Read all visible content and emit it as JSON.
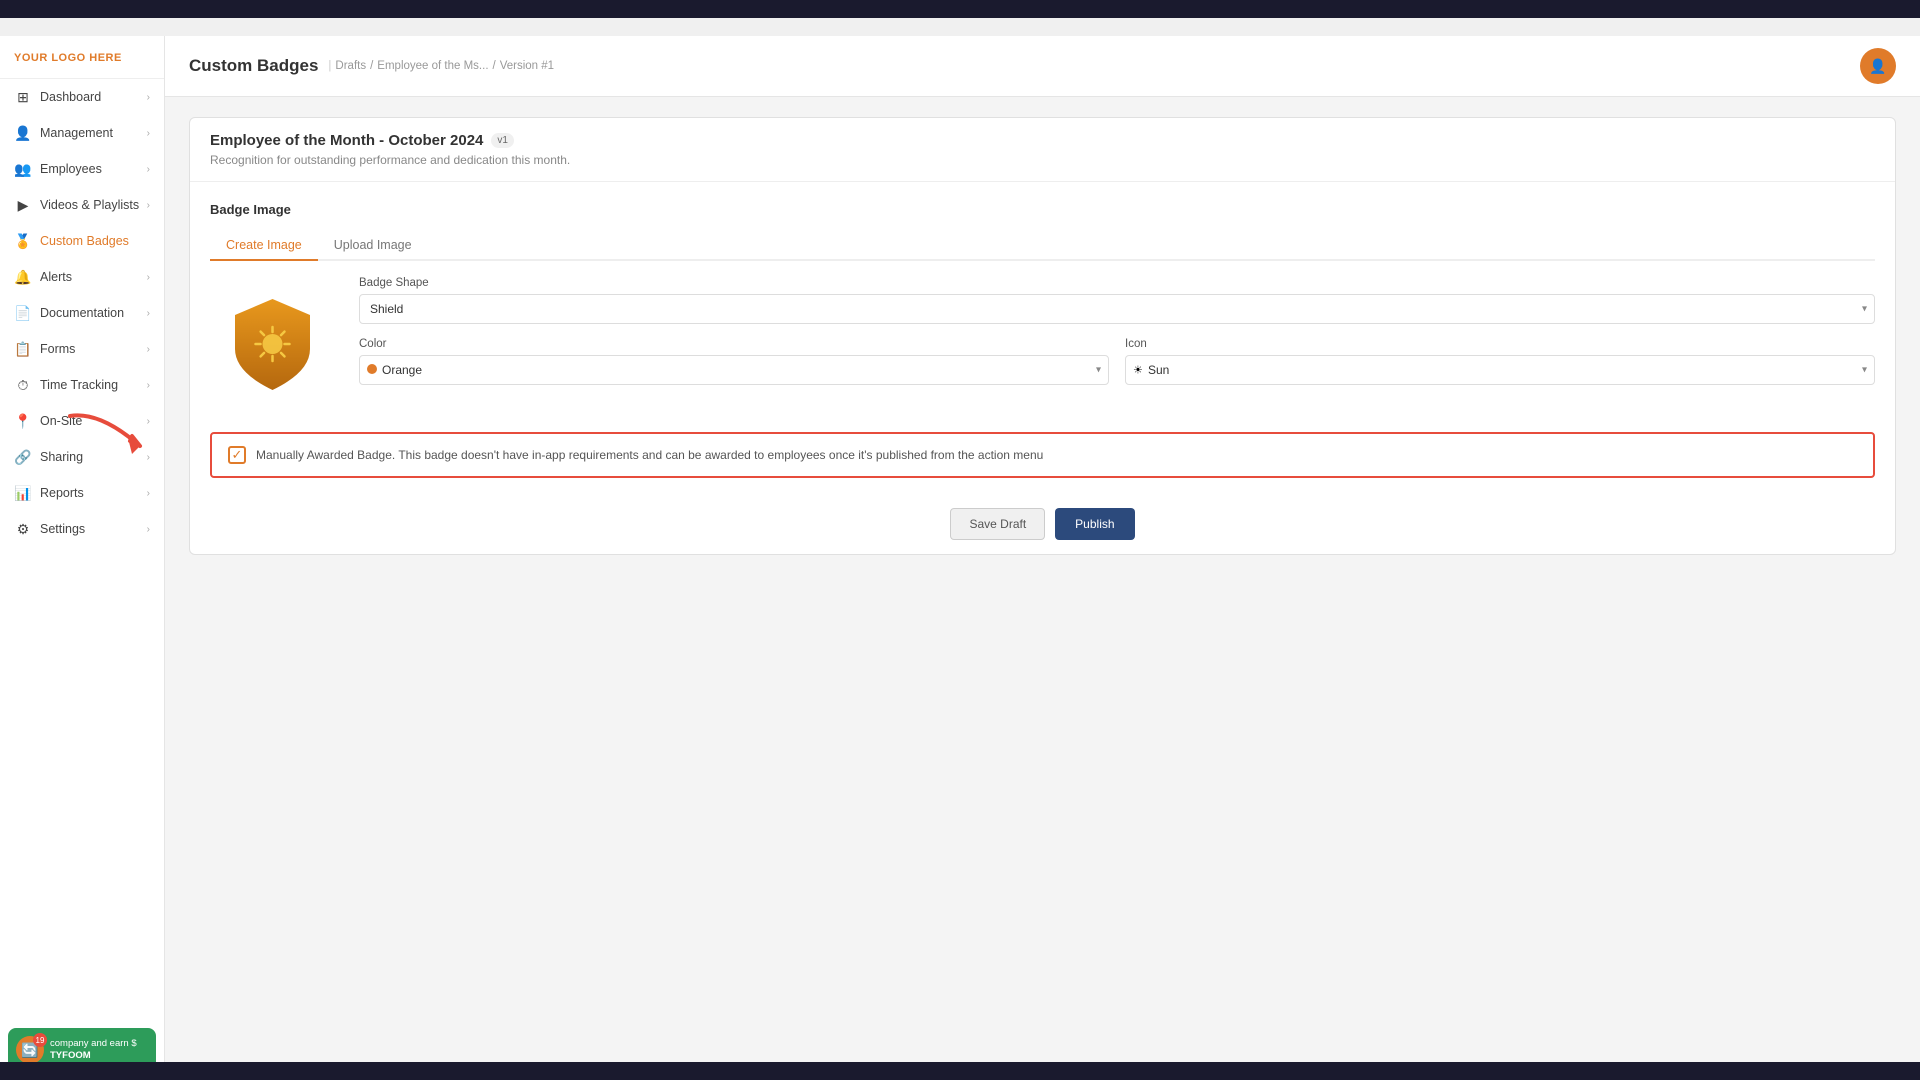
{
  "topBar": {
    "color": "#1a1a2e"
  },
  "sidebar": {
    "logo": "YOUR LOGO HERE",
    "items": [
      {
        "id": "dashboard",
        "label": "Dashboard",
        "icon": "⊞",
        "hasChevron": true
      },
      {
        "id": "management",
        "label": "Management",
        "icon": "👤",
        "hasChevron": true
      },
      {
        "id": "employees",
        "label": "Employees",
        "icon": "👥",
        "hasChevron": true
      },
      {
        "id": "videos-playlists",
        "label": "Videos & Playlists",
        "icon": "▶",
        "hasChevron": true
      },
      {
        "id": "custom-badges",
        "label": "Custom Badges",
        "icon": "🏅",
        "hasChevron": false,
        "active": true
      },
      {
        "id": "alerts",
        "label": "Alerts",
        "icon": "🔔",
        "hasChevron": true
      },
      {
        "id": "documentation",
        "label": "Documentation",
        "icon": "📄",
        "hasChevron": true
      },
      {
        "id": "forms",
        "label": "Forms",
        "icon": "📋",
        "hasChevron": true
      },
      {
        "id": "time-tracking",
        "label": "Time Tracking",
        "icon": "⏱",
        "hasChevron": true
      },
      {
        "id": "on-site",
        "label": "On-Site",
        "icon": "📍",
        "hasChevron": true
      },
      {
        "id": "sharing",
        "label": "Sharing",
        "icon": "🔗",
        "hasChevron": true
      },
      {
        "id": "reports",
        "label": "Reports",
        "icon": "📊",
        "hasChevron": true
      },
      {
        "id": "settings",
        "label": "Settings",
        "icon": "⚙",
        "hasChevron": true
      }
    ],
    "promo": {
      "badge_count": "19",
      "text": "company and earn $",
      "brand": "TYFOOM"
    }
  },
  "header": {
    "title": "Custom Badges",
    "breadcrumbs": [
      "Drafts",
      "Employee of the Ms...",
      "Version #1"
    ],
    "userAvatar": "👤"
  },
  "badge": {
    "title": "Employee of the Month - October 2024",
    "version": "v1",
    "description": "Recognition for outstanding performance and dedication this month.",
    "sectionLabel": "Badge Image",
    "tabs": [
      {
        "id": "create",
        "label": "Create Image",
        "active": true
      },
      {
        "id": "upload",
        "label": "Upload Image",
        "active": false
      }
    ],
    "shapeLabel": "Badge Shape",
    "shapeValue": "Shield",
    "colorLabel": "Color",
    "colorValue": "Orange",
    "iconLabel": "Icon",
    "iconValue": "Sun",
    "noticeText": "Manually Awarded Badge. This badge doesn't have in-app requirements and can be awarded to employees once it's published from the action menu",
    "buttons": {
      "saveDraft": "Save Draft",
      "publish": "Publish"
    }
  }
}
